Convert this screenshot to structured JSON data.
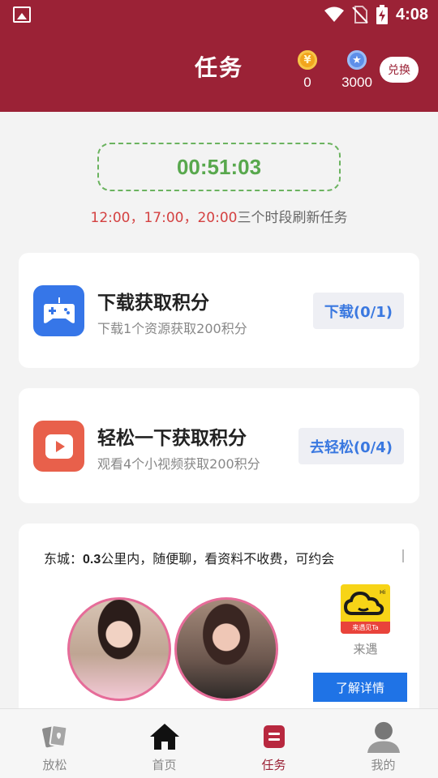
{
  "status_bar": {
    "time": "4:08",
    "icons": [
      "image-icon",
      "wifi-icon",
      "no-sim-icon",
      "battery-charging-icon"
    ]
  },
  "header": {
    "title": "任务",
    "gold_coins": "0",
    "gold_coin_glyph": "¥",
    "points": "3000",
    "points_glyph": "★",
    "exchange_label": "兑换"
  },
  "countdown": {
    "value": "00:51:03",
    "refresh_times": "12:00，17:00，20:00",
    "refresh_suffix": "三个时段刷新任务"
  },
  "tasks": [
    {
      "title": "下载获取积分",
      "subtitle": "下载1个资源获取200积分",
      "button_label": "下载(0/1)",
      "icon": "gamepad-icon"
    },
    {
      "title": "轻松一下获取积分",
      "subtitle": "观看4个小视频获取200积分",
      "button_label": "去轻松(0/4)",
      "icon": "play-video-icon"
    }
  ],
  "ad": {
    "text_prefix": "东城：",
    "text_distance": "0.3",
    "text_suffix": "公里内，随便聊，看资料不收费，可约会",
    "app_name": "来遇",
    "app_logo_text": "来遇见Ta",
    "button_label": "了解详情"
  },
  "tabbar": {
    "tabs": [
      {
        "label": "放松",
        "icon": "cards-icon",
        "active": false
      },
      {
        "label": "首页",
        "icon": "home-icon",
        "active": false
      },
      {
        "label": "任务",
        "icon": "task-icon",
        "active": true
      },
      {
        "label": "我的",
        "icon": "user-icon",
        "active": false
      }
    ]
  },
  "colors": {
    "brand": "#9b2236",
    "timer_green": "#58a84d",
    "link_blue": "#3a78e0",
    "refresh_red": "#d44141"
  }
}
